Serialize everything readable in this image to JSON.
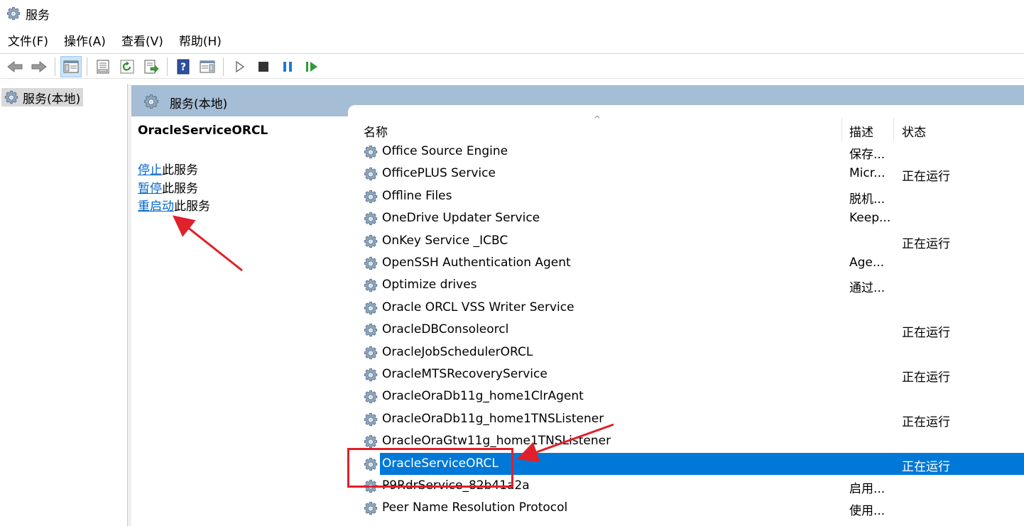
{
  "window": {
    "title": "服务",
    "icon": "gear-icon"
  },
  "menu": [
    "文件(F)",
    "操作(A)",
    "查看(V)",
    "帮助(H)"
  ],
  "toolbar": {
    "buttons": [
      "back-arrow-icon",
      "forward-arrow-icon",
      "console-tree-icon",
      "properties-icon",
      "refresh-icon",
      "export-list-icon",
      "help-icon",
      "action-pane-icon",
      "start-service-icon",
      "stop-service-icon",
      "pause-service-icon",
      "resume-service-icon"
    ]
  },
  "tree": {
    "item": "服务(本地)"
  },
  "header": {
    "title": "服务(本地)"
  },
  "description": {
    "title": "OracleServiceORCL",
    "stop_link": "停止",
    "stop_suffix": "此服务",
    "pause_link": "暂停",
    "pause_suffix": "此服务",
    "restart_link": "重启动",
    "restart_suffix": "此服务"
  },
  "columns": {
    "name": "名称",
    "desc": "描述",
    "status": "状态",
    "sort_indicator": "^"
  },
  "services": [
    {
      "name": "Office  Source Engine",
      "desc": "保存...",
      "status": ""
    },
    {
      "name": "OfficePLUS Service",
      "desc": "Micr...",
      "status": "正在运行"
    },
    {
      "name": "Offline Files",
      "desc": "脱机...",
      "status": ""
    },
    {
      "name": "OneDrive Updater Service",
      "desc": "Keep...",
      "status": ""
    },
    {
      "name": "OnKey Service _ICBC",
      "desc": "",
      "status": "正在运行"
    },
    {
      "name": "OpenSSH Authentication Agent",
      "desc": "Age...",
      "status": ""
    },
    {
      "name": "Optimize drives",
      "desc": "通过...",
      "status": ""
    },
    {
      "name": "Oracle ORCL VSS Writer Service",
      "desc": "",
      "status": ""
    },
    {
      "name": "OracleDBConsoleorcl",
      "desc": "",
      "status": "正在运行"
    },
    {
      "name": "OracleJobSchedulerORCL",
      "desc": "",
      "status": ""
    },
    {
      "name": "OracleMTSRecoveryService",
      "desc": "",
      "status": "正在运行"
    },
    {
      "name": "OracleOraDb11g_home1ClrAgent",
      "desc": "",
      "status": ""
    },
    {
      "name": "OracleOraDb11g_home1TNSListener",
      "desc": "",
      "status": "正在运行"
    },
    {
      "name": "OracleOraGtw11g_home1TNSListener",
      "desc": "",
      "status": ""
    },
    {
      "name": "OracleServiceORCL",
      "desc": "",
      "status": "正在运行",
      "selected": true
    },
    {
      "name": "P9RdrService_82b41a2a",
      "desc": "启用...",
      "status": ""
    },
    {
      "name": "Peer Name Resolution Protocol",
      "desc": "使用...",
      "status": ""
    }
  ],
  "colors": {
    "header_bg": "#a5bdd5",
    "selection": "#0078d7",
    "link": "#0066cc",
    "annotation_red": "#e0202a"
  }
}
